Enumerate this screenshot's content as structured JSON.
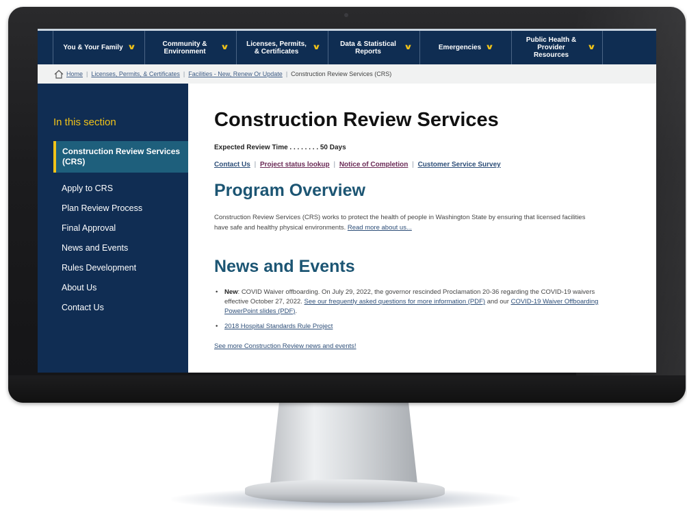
{
  "nav": {
    "items": [
      {
        "label": "You & Your Family"
      },
      {
        "label": "Community & Environment"
      },
      {
        "label": "Licenses, Permits, & Certificates"
      },
      {
        "label": "Data & Statistical Reports"
      },
      {
        "label": "Emergencies"
      },
      {
        "label": "Public Health & Provider Resources"
      }
    ],
    "chevron": "⌄"
  },
  "breadcrumb": {
    "home": "Home",
    "licenses": "Licenses, Permits, & Certificates",
    "facilities": "Facilities - New, Renew Or Update",
    "current": "Construction Review Services (CRS)",
    "separator": "|"
  },
  "sidebar": {
    "title": "In this section",
    "active": "Construction Review Services (CRS)",
    "items": [
      {
        "label": "Apply to CRS"
      },
      {
        "label": "Plan Review Process"
      },
      {
        "label": "Final Approval"
      },
      {
        "label": "News and Events"
      },
      {
        "label": "Rules Development"
      },
      {
        "label": "About Us"
      },
      {
        "label": "Contact Us"
      }
    ]
  },
  "main": {
    "title": "Construction Review Services",
    "review_time": "Expected Review Time . . . . . . . . 50 Days",
    "links": {
      "contact": "Contact Us",
      "status": "Project status lookup",
      "completion": "Notice of Completion",
      "survey": "Customer Service Survey"
    },
    "overview": {
      "heading": "Program Overview",
      "text": "Construction Review Services (CRS) works to protect the health of people in Washington State by ensuring that licensed facilities have safe and healthy physical environments.",
      "read_more": "Read more about us..."
    },
    "news": {
      "heading": "News and Events",
      "item1_label": "New",
      "item1_text": ": COVID Waiver offboarding. On July 29, 2022, the governor rescinded Proclamation 20-36 regarding the COVID-19 waivers effective October 27, 2022.",
      "item1_link1": "See our frequently asked questions for more information (PDF)",
      "item1_and": "and our",
      "item1_link2": "COVID-19 Waiver Offboarding PowerPoint slides (PDF)",
      "item1_end": ".",
      "item2_link": "2018 Hospital Standards Rule Project",
      "more": "See more Construction Review news and events!"
    }
  },
  "colors": {
    "nav_bg": "#0f2d52",
    "accent_yellow": "#f1c319",
    "active_teal": "#1e5f7c",
    "heading_teal": "#1c5573",
    "link_blue": "#2d4e78"
  }
}
